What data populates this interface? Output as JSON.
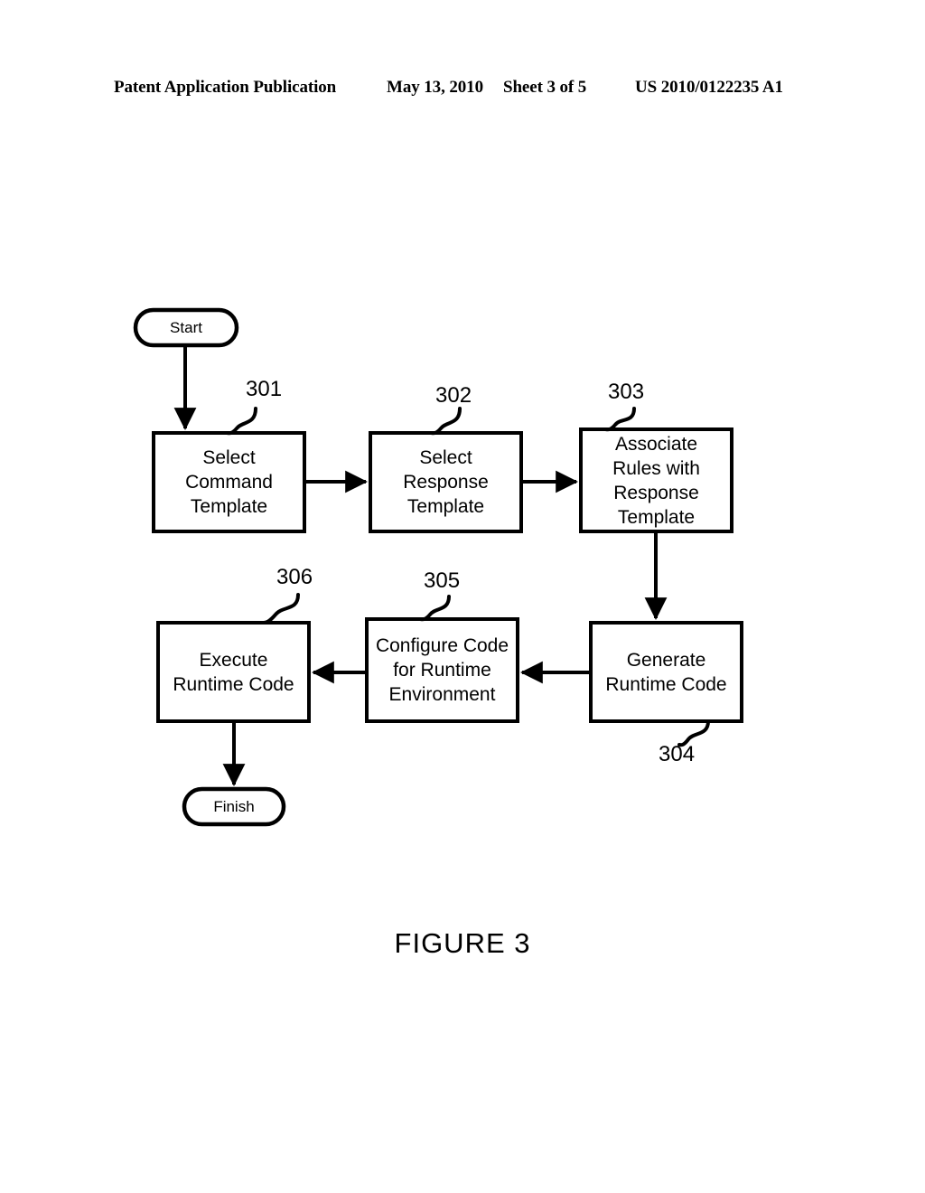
{
  "header": {
    "publication": "Patent Application Publication",
    "date": "May 13, 2010",
    "sheet": "Sheet 3 of 5",
    "patent_number": "US 2010/0122235 A1"
  },
  "figure": {
    "caption": "FIGURE 3",
    "type": "flowchart"
  },
  "terminals": {
    "start": "Start",
    "finish": "Finish"
  },
  "steps": [
    {
      "ref": "301",
      "label": "Select\nCommand\nTemplate"
    },
    {
      "ref": "302",
      "label": "Select\nResponse\nTemplate"
    },
    {
      "ref": "303",
      "label": "Associate\nRules with\nResponse\nTemplate"
    },
    {
      "ref": "304",
      "label": "Generate\nRuntime Code"
    },
    {
      "ref": "305",
      "label": "Configure Code\nfor Runtime\nEnvironment"
    },
    {
      "ref": "306",
      "label": "Execute\nRuntime Code"
    }
  ],
  "flow_edges": [
    {
      "from": "start",
      "to": "301"
    },
    {
      "from": "301",
      "to": "302"
    },
    {
      "from": "302",
      "to": "303"
    },
    {
      "from": "303",
      "to": "304"
    },
    {
      "from": "304",
      "to": "305"
    },
    {
      "from": "305",
      "to": "306"
    },
    {
      "from": "306",
      "to": "finish"
    }
  ],
  "colors": {
    "ink": "#000000",
    "paper": "#ffffff"
  }
}
